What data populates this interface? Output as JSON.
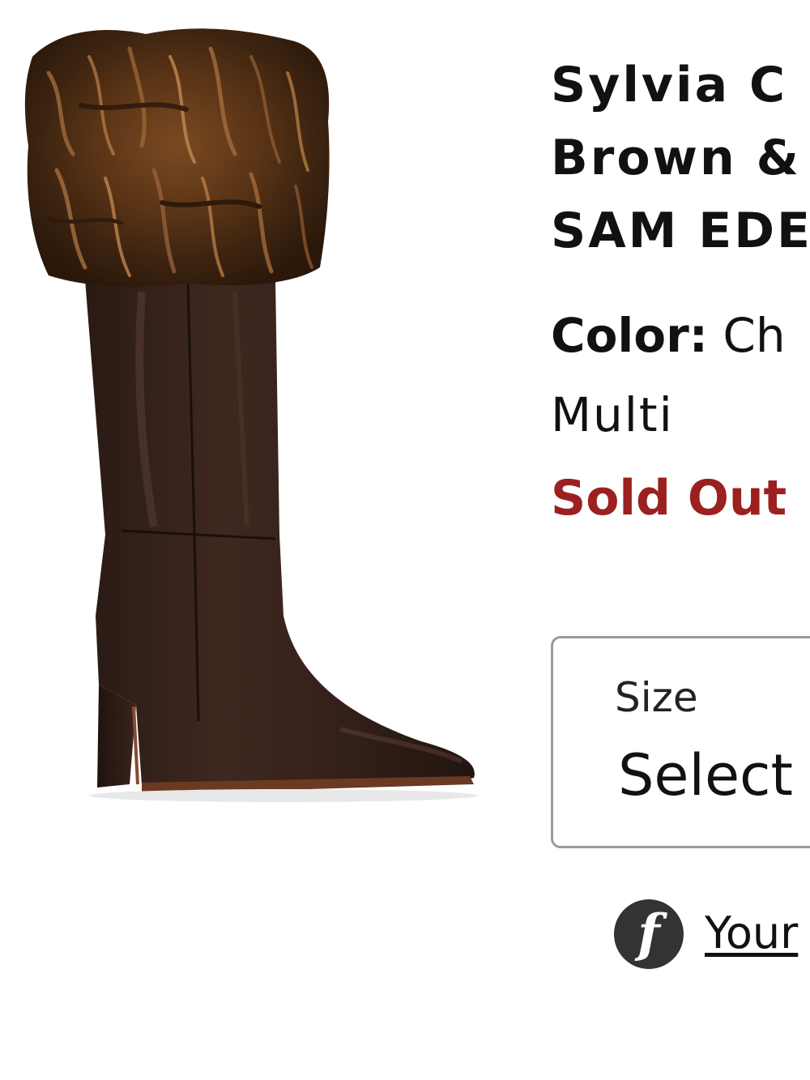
{
  "product": {
    "title_line_1": "Sylvia C",
    "title_line_2": "Brown &",
    "title_line_3": "SAM EDE",
    "color_label": "Color:",
    "color_value_part_1": "Ch",
    "color_value_part_2": "Multi",
    "stock_status": "Sold Out",
    "image_alt": "Fur cuff knee-high boot",
    "status_color": "#9b2020"
  },
  "size_selector": {
    "label": "Size",
    "value": "Select"
  },
  "promo": {
    "icon": "f-logo-icon",
    "icon_glyph": "f",
    "link_text": "Your"
  }
}
